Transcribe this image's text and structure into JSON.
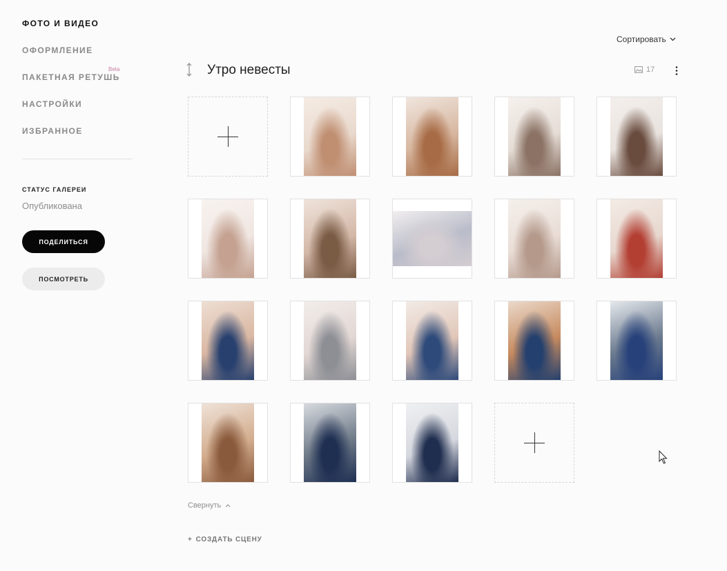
{
  "sidebar": {
    "nav": [
      {
        "label": "ФОТО И ВИДЕО",
        "active": true
      },
      {
        "label": "ОФОРМЛЕНИЕ",
        "active": false
      },
      {
        "label": "ПАКЕТНАЯ РЕТУШЬ",
        "active": false,
        "badge": "Beta"
      },
      {
        "label": "НАСТРОЙКИ",
        "active": false
      },
      {
        "label": "ИЗБРАННОЕ",
        "active": false
      }
    ],
    "status_title": "СТАТУС ГАЛЕРЕИ",
    "status_value": "Опубликована",
    "share_label": "ПОДЕЛИТЬСЯ",
    "view_label": "ПОСМОТРЕТЬ"
  },
  "header": {
    "sort_label": "Сортировать"
  },
  "scene": {
    "title": "Утро невесты",
    "count": "17",
    "photos": [
      {
        "kind": "add"
      },
      {
        "kind": "photo",
        "colors": [
          "#c08f72",
          "#e9d9cd",
          "#f5ece4"
        ]
      },
      {
        "kind": "photo",
        "colors": [
          "#a76b45",
          "#d7b7a0",
          "#f0e5dd"
        ]
      },
      {
        "kind": "photo",
        "colors": [
          "#8b7264",
          "#e5ddd6",
          "#f6f1ed"
        ]
      },
      {
        "kind": "photo",
        "colors": [
          "#6a4c3e",
          "#e9e3df",
          "#f4efec"
        ]
      },
      {
        "kind": "photo",
        "colors": [
          "#c4a190",
          "#f0e6e2",
          "#f8f3f0"
        ]
      },
      {
        "kind": "photo",
        "colors": [
          "#7a5c45",
          "#d4b8a8",
          "#efe3da"
        ]
      },
      {
        "kind": "photo-land",
        "colors": [
          "#d4cdd2",
          "#b9bcc9",
          "#f1eeef"
        ]
      },
      {
        "kind": "photo",
        "colors": [
          "#b59a8c",
          "#e9ddd6",
          "#f5f0ec"
        ]
      },
      {
        "kind": "photo",
        "colors": [
          "#b33f33",
          "#e7d8cf",
          "#f3ebe5"
        ]
      },
      {
        "kind": "photo",
        "colors": [
          "#27406e",
          "#d9b7a2",
          "#eeded3"
        ]
      },
      {
        "kind": "photo",
        "colors": [
          "#8d8f95",
          "#e2d7d4",
          "#f2edea"
        ]
      },
      {
        "kind": "photo",
        "colors": [
          "#2d4a7a",
          "#e1c6b8",
          "#f2ebe6"
        ]
      },
      {
        "kind": "photo",
        "colors": [
          "#24406e",
          "#c68a5e",
          "#ebd9ca"
        ]
      },
      {
        "kind": "photo",
        "colors": [
          "#27417a",
          "#6b7a8e",
          "#e4e8ec"
        ]
      },
      {
        "kind": "photo",
        "colors": [
          "#8a5a3c",
          "#d3ad8e",
          "#efe2d8"
        ]
      },
      {
        "kind": "photo",
        "colors": [
          "#1f2f52",
          "#6e7a88",
          "#d7dadf"
        ]
      },
      {
        "kind": "photo",
        "colors": [
          "#1f2d4e",
          "#d6d8df",
          "#eef0f2"
        ]
      },
      {
        "kind": "add"
      }
    ],
    "collapse_label": "Свернуть"
  },
  "create_scene_label": "СОЗДАТЬ СЦЕНУ"
}
